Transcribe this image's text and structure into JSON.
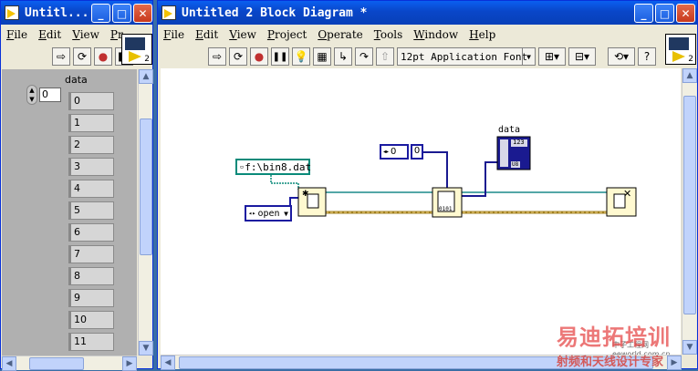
{
  "front_panel": {
    "title": "Untitl...",
    "menu": [
      "File",
      "Edit",
      "View",
      "Pr"
    ],
    "array_label": "data",
    "index_value": "0",
    "array_values": [
      "0",
      "1",
      "2",
      "3",
      "4",
      "5",
      "6",
      "7",
      "8",
      "9",
      "10",
      "11"
    ],
    "vi_icon_num": "2"
  },
  "block_diagram": {
    "title": "Untitled 2 Block Diagram *",
    "menu": [
      "File",
      "Edit",
      "View",
      "Project",
      "Operate",
      "Tools",
      "Window",
      "Help"
    ],
    "font_select": "12pt Application Font",
    "vi_icon_num": "2",
    "path_constant": "f:\\bin8.dat",
    "enum_value": "open",
    "numeric_constant": "0",
    "indicator_label": "data",
    "indicator_type": "123",
    "indicator_rep": "U8"
  },
  "watermark": {
    "brand": "易迪拓培训",
    "slogan": "射频和天线设计专家",
    "site": "中子工程网 eeworld.com.cn"
  }
}
